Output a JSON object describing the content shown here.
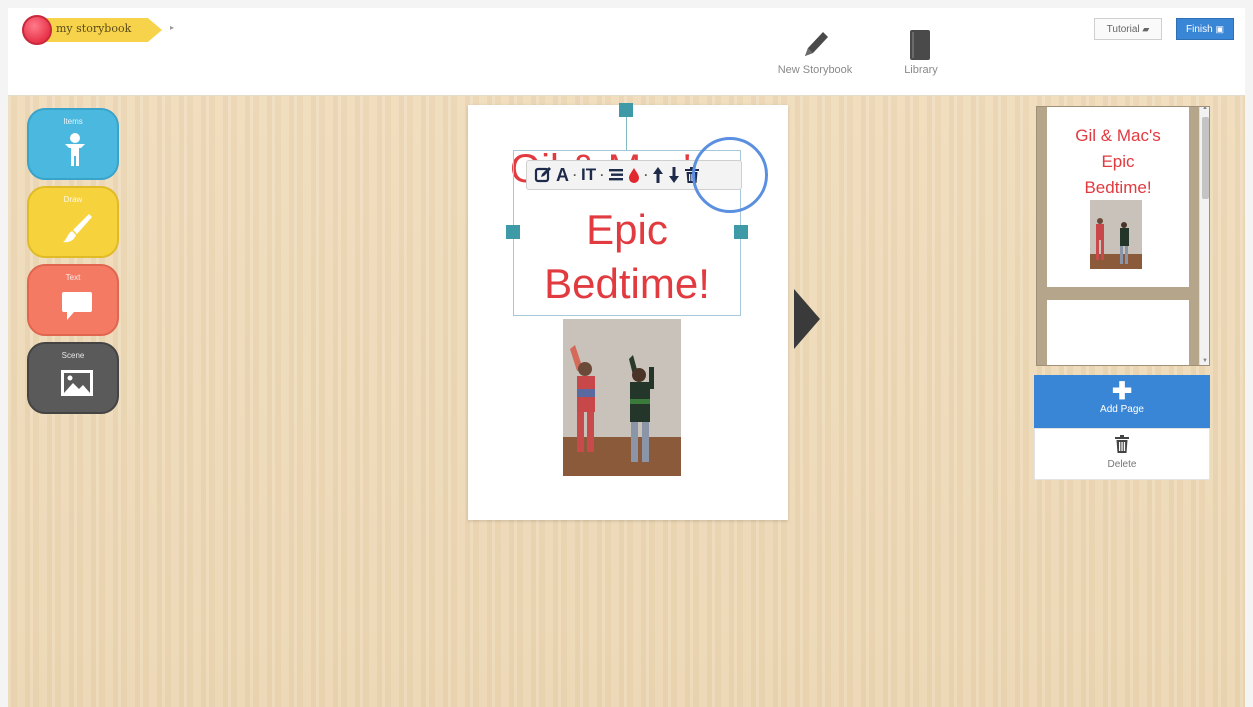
{
  "app": {
    "logo_text": "my storybook",
    "nav": {
      "new_storybook": "New Storybook",
      "library": "Library"
    },
    "tutorial_label": "Tutorial",
    "finish_label": "Finish"
  },
  "tools": [
    {
      "label": "Items",
      "color": "#4bb8df",
      "icon": "person-icon"
    },
    {
      "label": "Draw",
      "color": "#f6d33c",
      "icon": "brush-icon"
    },
    {
      "label": "Text",
      "color": "#f57a64",
      "icon": "speech-bubble-icon"
    },
    {
      "label": "Scene",
      "color": "#5a5a5a",
      "icon": "picture-icon"
    }
  ],
  "page": {
    "title_line1": "Gil & Mac's",
    "title_line2": "Epic",
    "title_line3": "Bedtime!",
    "toolbar_icons": [
      "edit-icon",
      "font-icon",
      "text-size-icon",
      "align-icon",
      "color-drop-icon",
      "move-up-icon",
      "move-down-icon",
      "trash-icon"
    ],
    "text_color": "#e13a3f"
  },
  "sidebar": {
    "thumbnail_title_lines": [
      "Gil & Mac's",
      "Epic",
      "Bedtime!"
    ],
    "add_page_label": "Add Page",
    "delete_label": "Delete"
  }
}
